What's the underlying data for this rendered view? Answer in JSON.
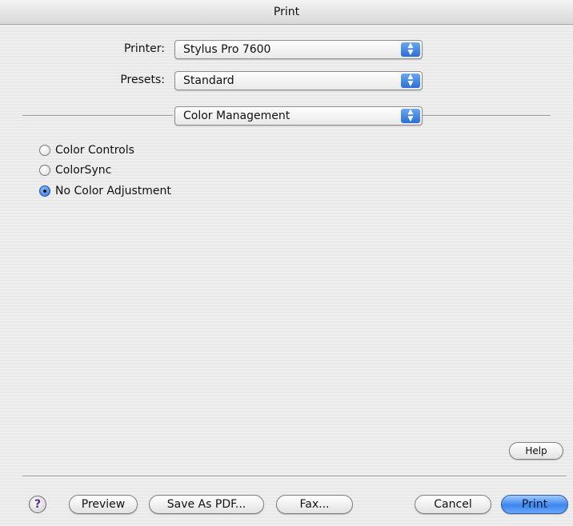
{
  "window": {
    "title": "Print"
  },
  "printer": {
    "label": "Printer:",
    "value": "Stylus Pro 7600"
  },
  "presets": {
    "label": "Presets:",
    "value": "Standard"
  },
  "pane": {
    "value": "Color Management"
  },
  "color_options": [
    {
      "label": "Color Controls",
      "selected": false
    },
    {
      "label": "ColorSync",
      "selected": false
    },
    {
      "label": "No Color Adjustment",
      "selected": true
    }
  ],
  "help_button": {
    "label": "Help"
  },
  "footer": {
    "help_icon": "?",
    "preview": "Preview",
    "save_pdf": "Save As PDF...",
    "fax": "Fax...",
    "cancel": "Cancel",
    "print": "Print"
  },
  "colors": {
    "accent": "#3d86ec"
  }
}
